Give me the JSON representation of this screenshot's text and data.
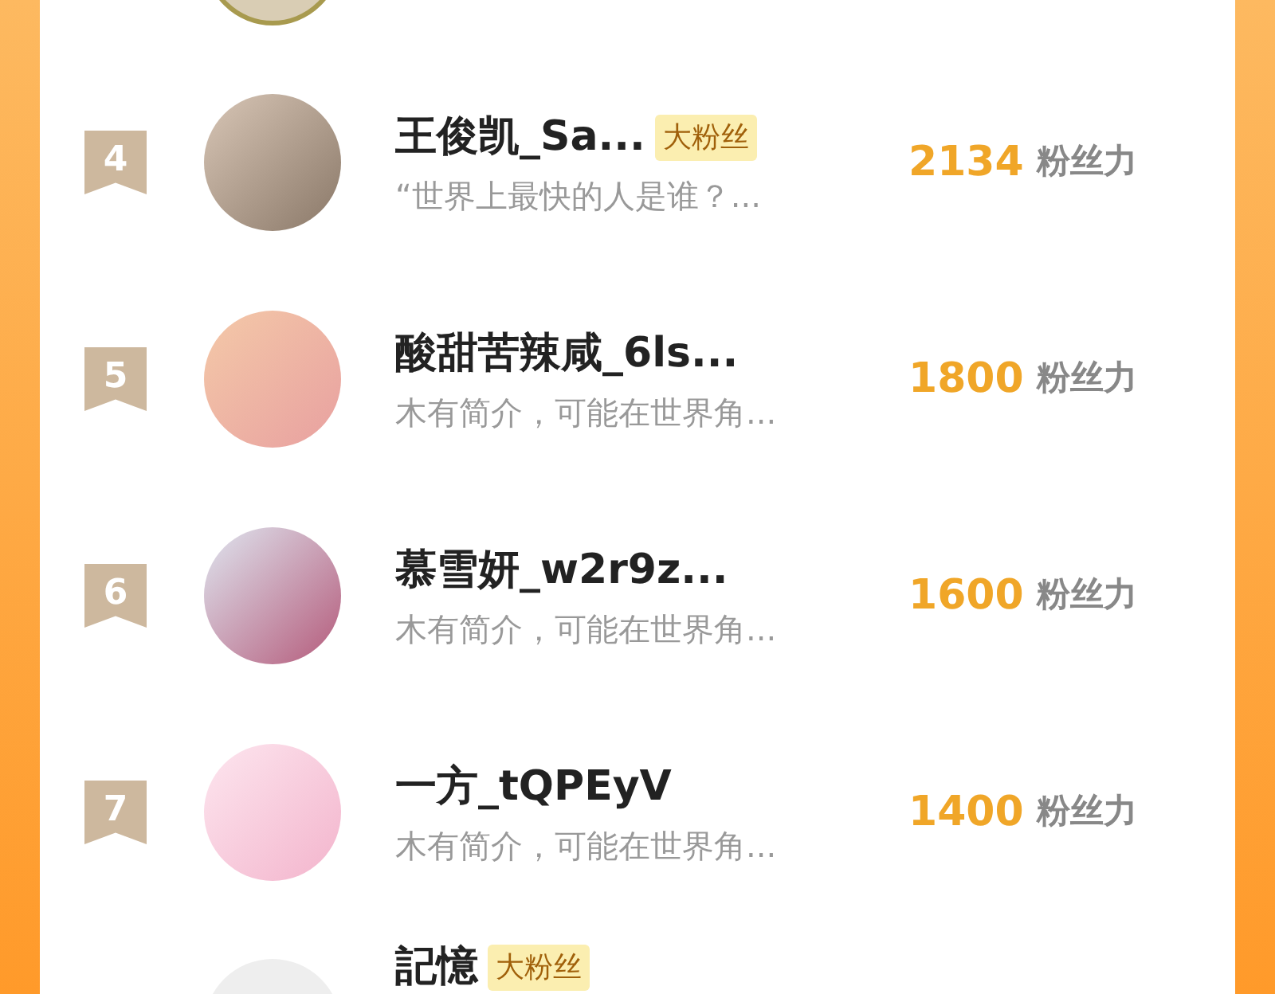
{
  "rows": [
    {
      "rank": "4",
      "name": "王俊凯_Sa...",
      "badge": "大粉丝",
      "bio": "“世界上最快的人是谁？...",
      "score": "2134",
      "unit": "粉丝力"
    },
    {
      "rank": "5",
      "name": "酸甜苦辣咸_6ls...",
      "bio": "木有简介，可能在世界角...",
      "score": "1800",
      "unit": "粉丝力"
    },
    {
      "rank": "6",
      "name": "慕雪妍_w2r9z...",
      "bio": "木有简介，可能在世界角...",
      "score": "1600",
      "unit": "粉丝力"
    },
    {
      "rank": "7",
      "name": "一方_tQPEyV",
      "bio": "木有简介，可能在世界角...",
      "score": "1400",
      "unit": "粉丝力"
    },
    {
      "name": "記憶",
      "badge": "大粉丝"
    }
  ]
}
